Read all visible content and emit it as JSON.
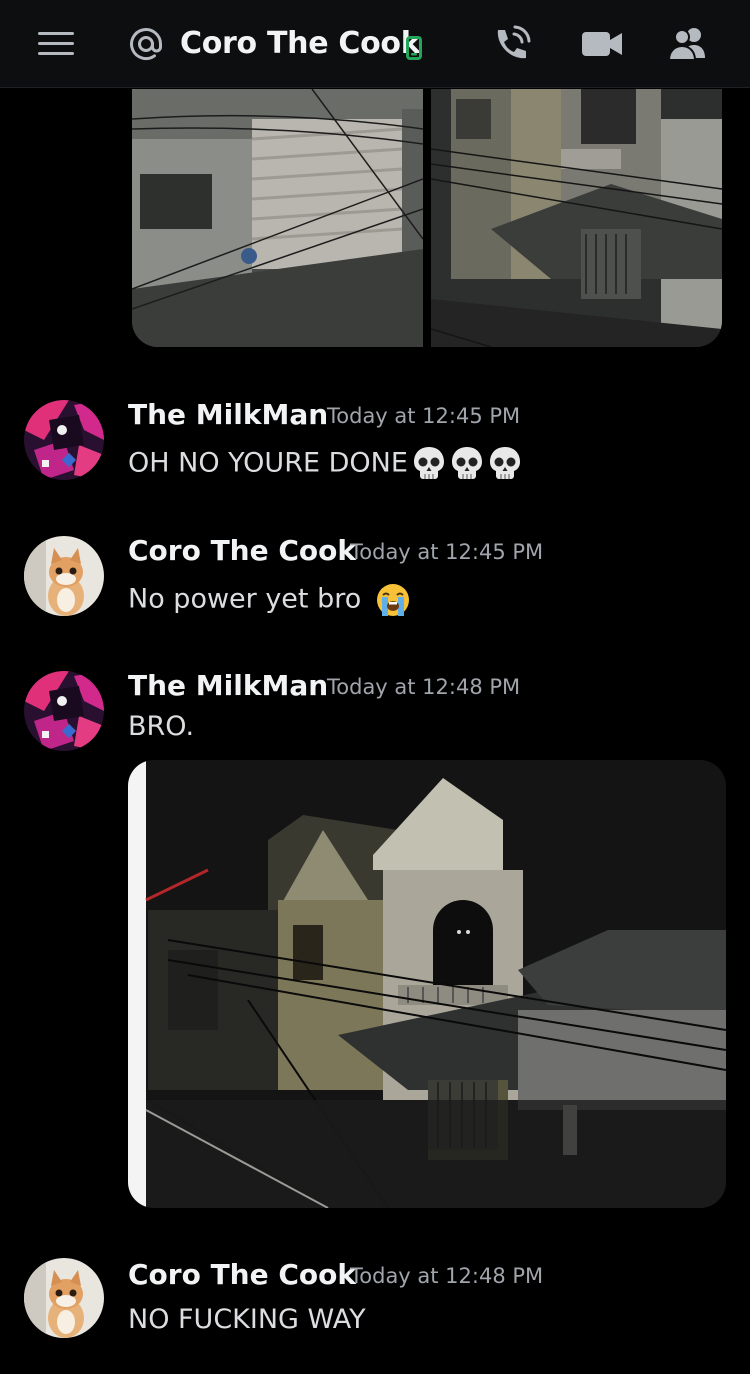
{
  "header": {
    "channel_name": "Coro The Cook",
    "status": "mobile-online",
    "icons": [
      "hamburger-menu-icon",
      "at-icon",
      "mobile-icon",
      "voice-call-icon",
      "video-call-icon",
      "members-icon"
    ]
  },
  "colors": {
    "background": "#000000",
    "header_bg": "#0d0e10",
    "online_green": "#23a55a",
    "username": "#f2f3f5",
    "timestamp": "#a0a4ab"
  },
  "messages": [
    {
      "author": "The MilkMan",
      "timestamp": "Today at 12:45 PM",
      "text": "OH NO YOURE DONE",
      "emojis": [
        "skull",
        "skull",
        "skull"
      ]
    },
    {
      "author": "Coro The Cook",
      "timestamp": "Today at 12:45 PM",
      "text": "No power yet bro",
      "emojis": [
        "loudly-crying-face"
      ]
    },
    {
      "author": "The MilkMan",
      "timestamp": "Today at 12:48 PM",
      "text": "BRO.",
      "attachment": "photo-night-houses"
    },
    {
      "author": "Coro The Cook",
      "timestamp": "Today at 12:48 PM",
      "text": "NO FUCKING WAY"
    }
  ]
}
